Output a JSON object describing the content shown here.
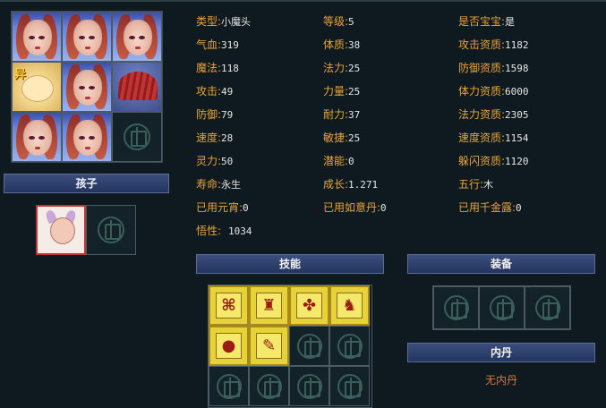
{
  "stats": [
    {
      "label": "类型:",
      "value": "小魔头"
    },
    {
      "label": "等级:",
      "value": "5"
    },
    {
      "label": "是否宝宝:",
      "value": "是"
    },
    {
      "label": "气血:",
      "value": "319"
    },
    {
      "label": "体质:",
      "value": "38"
    },
    {
      "label": "攻击资质:",
      "value": "1182"
    },
    {
      "label": "魔法:",
      "value": "118"
    },
    {
      "label": "法力:",
      "value": "25"
    },
    {
      "label": "防御资质:",
      "value": "1598"
    },
    {
      "label": "攻击:",
      "value": "49"
    },
    {
      "label": "力量:",
      "value": "25"
    },
    {
      "label": "体力资质:",
      "value": "6000"
    },
    {
      "label": "防御:",
      "value": "79"
    },
    {
      "label": "耐力:",
      "value": "37"
    },
    {
      "label": "法力资质:",
      "value": "2305"
    },
    {
      "label": "速度:",
      "value": "28"
    },
    {
      "label": "敏捷:",
      "value": "25"
    },
    {
      "label": "速度资质:",
      "value": "1154"
    },
    {
      "label": "灵力:",
      "value": "50"
    },
    {
      "label": "潜能:",
      "value": "0"
    },
    {
      "label": "躲闪资质:",
      "value": "1120"
    },
    {
      "label": "寿命:",
      "value": "永生"
    },
    {
      "label": "成长:",
      "value": "1.271"
    },
    {
      "label": "五行:",
      "value": "木"
    },
    {
      "label": "已用元宵:",
      "value": "0"
    },
    {
      "label": "已用如意丹:",
      "value": "0"
    },
    {
      "label": "已用千金露:",
      "value": "0"
    },
    {
      "label": "悟性:",
      "value": "1034"
    }
  ],
  "headers": {
    "children": "孩子",
    "skills": "技能",
    "equipment": "装备",
    "inner_core": "内丹"
  },
  "pig_badge": "异",
  "inner_core_empty": "无内丹",
  "skills": [
    "skill-icon-1",
    "skill-icon-2",
    "skill-icon-3",
    "skill-icon-4",
    "skill-icon-5",
    "skill-icon-6"
  ],
  "colors": {
    "label": "#e8a33a",
    "value": "#e6e6e6",
    "header_bg": "#2c3e6c",
    "background": "#0e1a1f",
    "empty_text": "#d87a3a"
  }
}
